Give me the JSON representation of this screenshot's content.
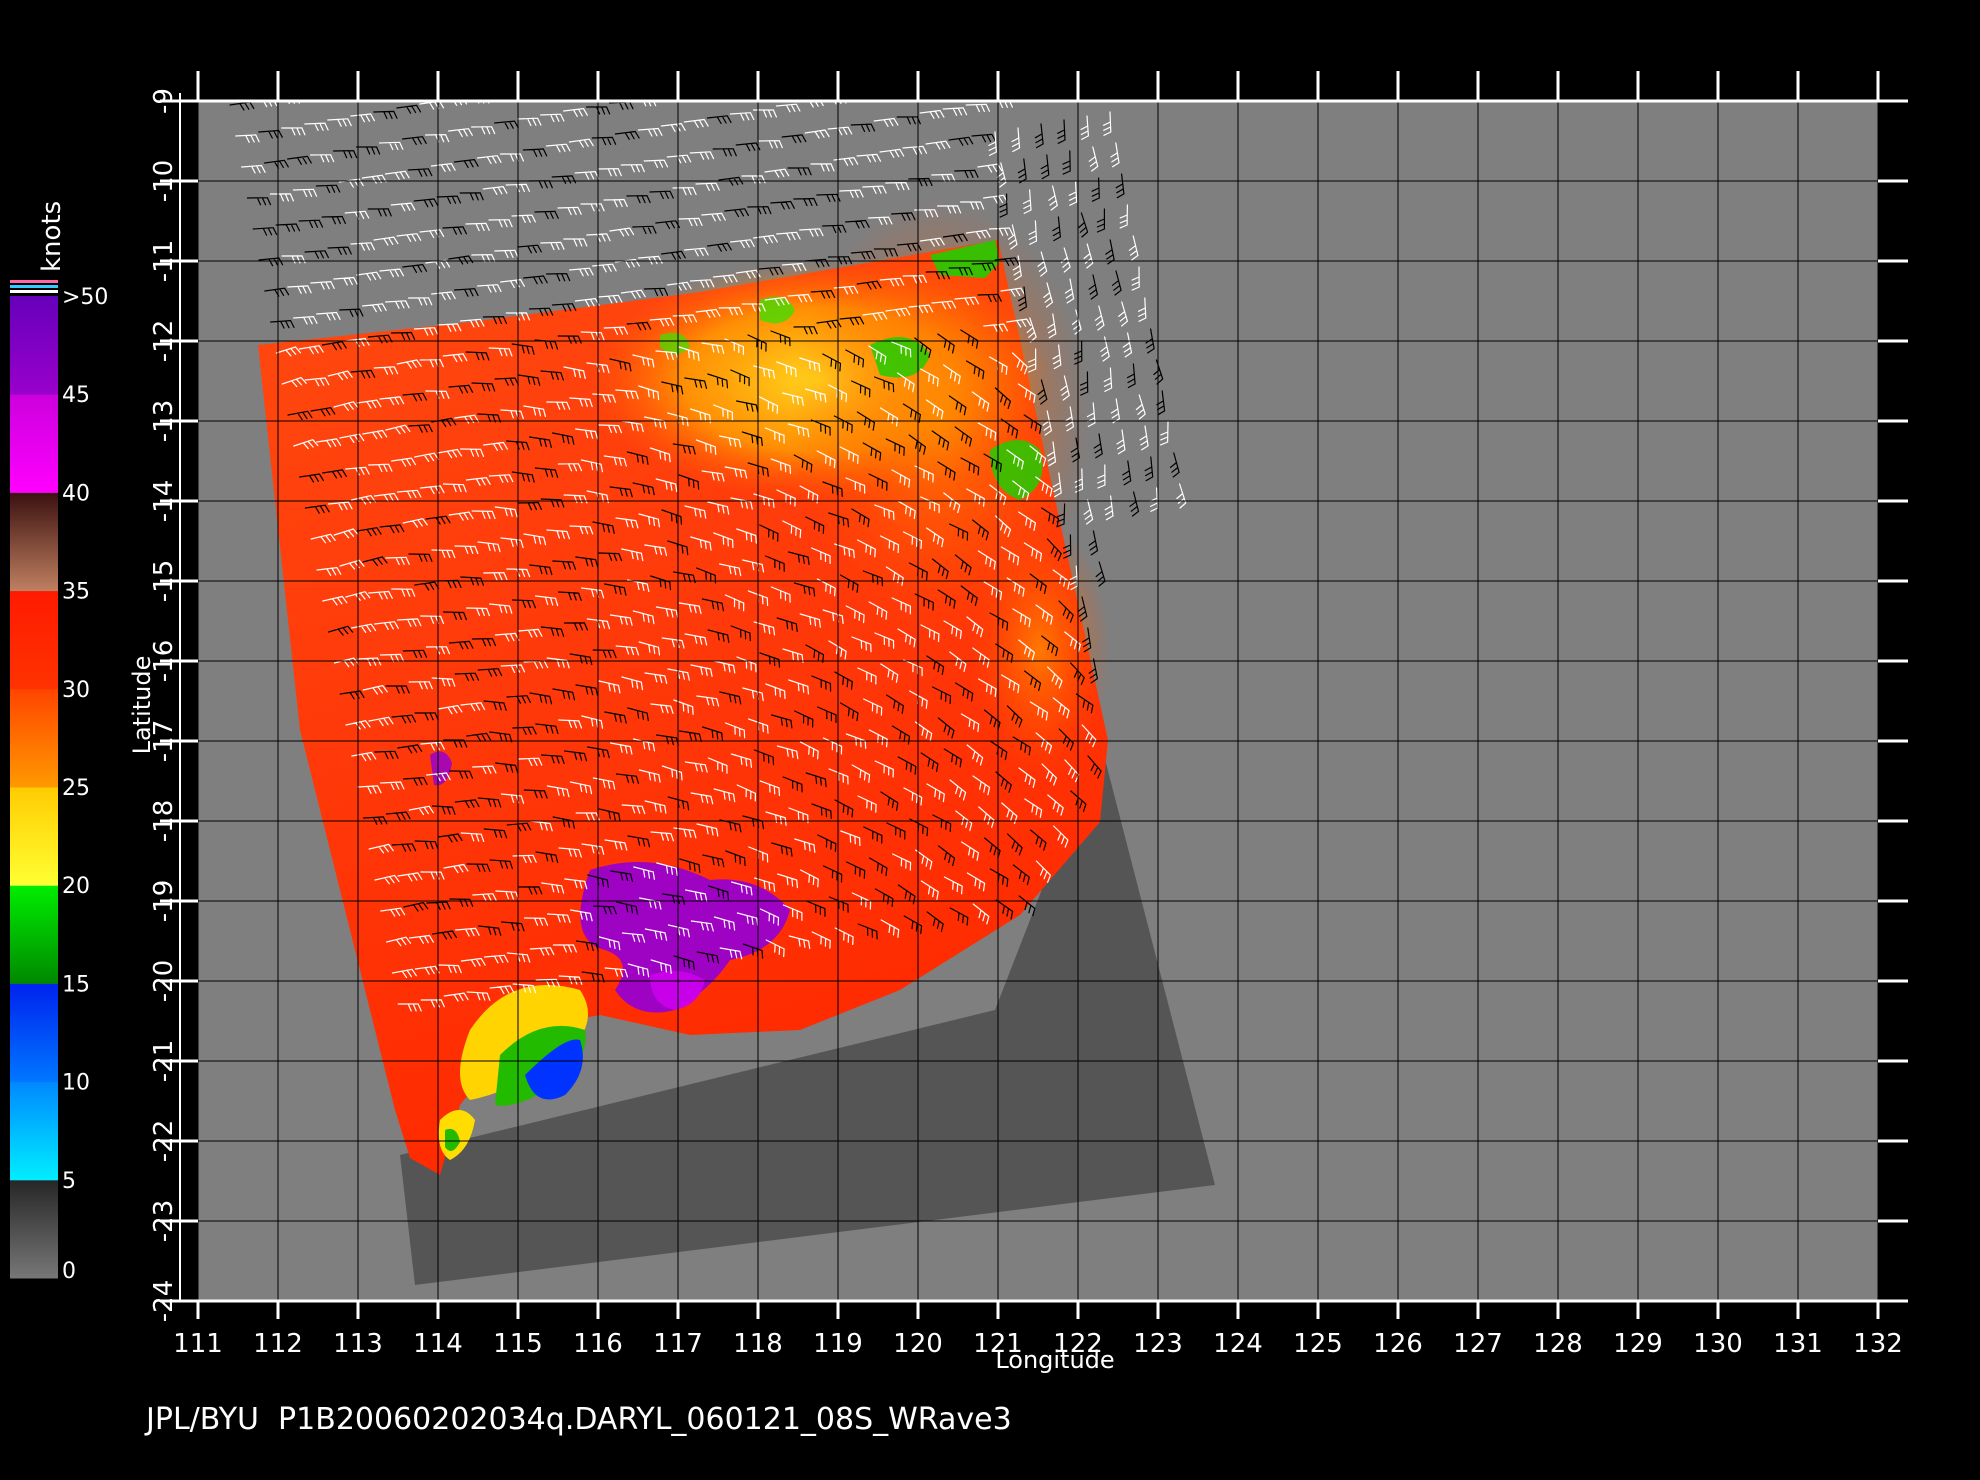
{
  "footer": "JPL/BYU  P1B20060202034q.DARYL_060121_08S_WRave3",
  "axes": {
    "xlabel": "Longitude",
    "ylabel": "Latitude",
    "x_ticks": [
      "111",
      "112",
      "113",
      "114",
      "115",
      "116",
      "117",
      "118",
      "119",
      "120",
      "121",
      "122",
      "123",
      "124",
      "125",
      "126",
      "127",
      "128",
      "129",
      "130",
      "131",
      "132"
    ],
    "y_ticks": [
      "-9",
      "-10",
      "-11",
      "-12",
      "-13",
      "-14",
      "-15",
      "-16",
      "-17",
      "-18",
      "-19",
      "-20",
      "-21",
      "-22",
      "-23",
      "-24"
    ],
    "lon_range": [
      111,
      132
    ],
    "lat_range": [
      -24,
      -9
    ]
  },
  "colorbar": {
    "unit": "knots",
    "labels": [
      "0",
      "5",
      "10",
      "15",
      "20",
      "25",
      "30",
      "35",
      "40",
      "45",
      ">50"
    ],
    "segments": [
      {
        "from": 0,
        "to": 5,
        "colors": [
          "#777777",
          "#262626"
        ]
      },
      {
        "from": 5,
        "to": 10,
        "colors": [
          "#00eeff",
          "#0088ff"
        ]
      },
      {
        "from": 10,
        "to": 15,
        "colors": [
          "#0077ff",
          "#0022ee"
        ]
      },
      {
        "from": 15,
        "to": 20,
        "colors": [
          "#008800",
          "#00ee00"
        ]
      },
      {
        "from": 20,
        "to": 25,
        "colors": [
          "#ffff33",
          "#ffcc00"
        ]
      },
      {
        "from": 25,
        "to": 30,
        "colors": [
          "#ff9900",
          "#ff4400"
        ]
      },
      {
        "from": 30,
        "to": 35,
        "colors": [
          "#ff3300",
          "#ff1a00"
        ]
      },
      {
        "from": 35,
        "to": 40,
        "colors": [
          "#c08060",
          "#3a1010"
        ]
      },
      {
        "from": 40,
        "to": 45,
        "colors": [
          "#ff00ff",
          "#cc00dd"
        ]
      },
      {
        "from": 45,
        "to": 50,
        "colors": [
          "#9900cc",
          "#6600bb"
        ]
      }
    ],
    "top_stripes": [
      "#ff66aa",
      "#33ccff",
      "#ffffff"
    ]
  },
  "map": {
    "background_color": "#7f7f7f",
    "swath_shadow_color": "#555555",
    "grid_color": "#000000"
  }
}
